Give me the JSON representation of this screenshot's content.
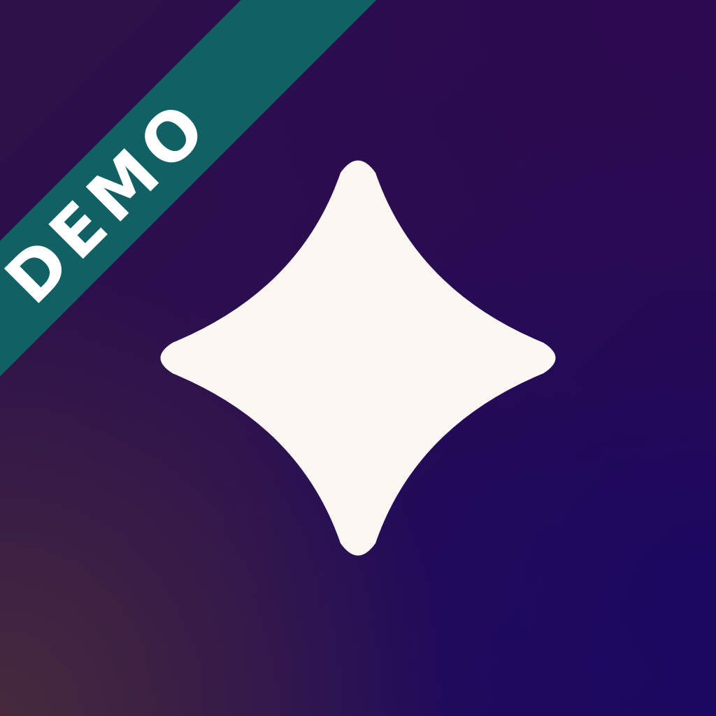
{
  "icon": {
    "glyph": "four-point-sparkle-icon",
    "glyph_color": "#fcf7f2"
  },
  "ribbon": {
    "label": "DEMO",
    "color": "#106064"
  },
  "colors": {
    "background_top_right": "#2c0850",
    "background_bottom_right": "#1c0860",
    "background_bottom_left": "#482a3c"
  }
}
